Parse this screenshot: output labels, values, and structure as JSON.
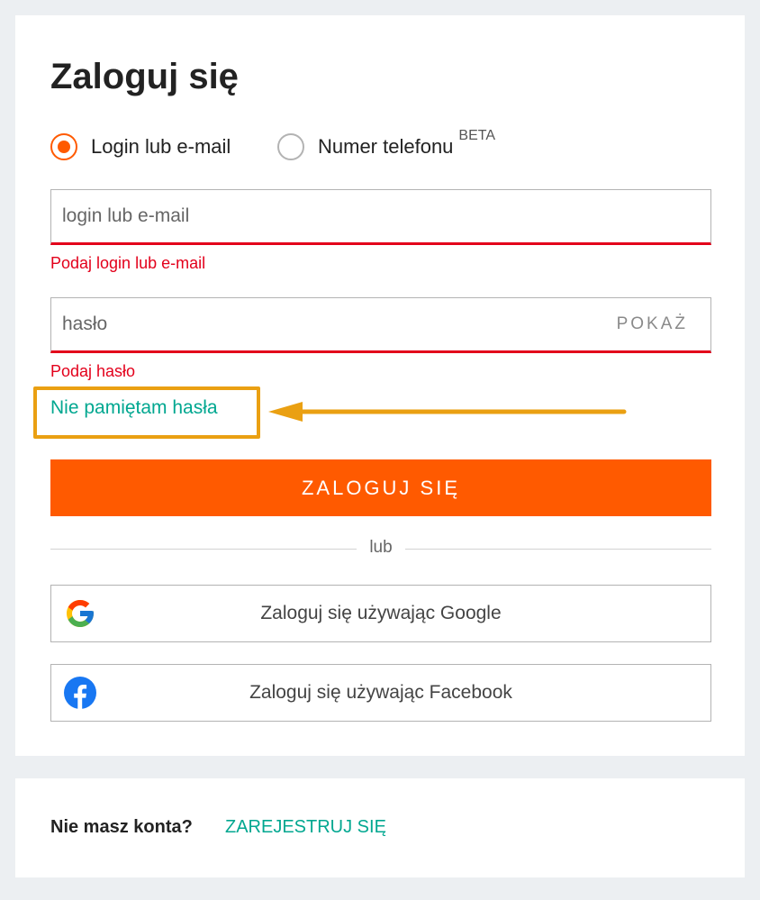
{
  "login": {
    "title": "Zaloguj się",
    "method_options": [
      {
        "label": "Login lub e-mail",
        "selected": true
      },
      {
        "label": "Numer telefonu",
        "badge": "BETA",
        "selected": false
      }
    ],
    "login_field": {
      "placeholder": "login lub e-mail",
      "value": "",
      "error": "Podaj login lub e-mail"
    },
    "password_field": {
      "placeholder": "hasło",
      "value": "",
      "show_label": "POKAŻ",
      "error": "Podaj hasło"
    },
    "forgot_password_label": "Nie pamiętam hasła",
    "submit_label": "ZALOGUJ SIĘ",
    "divider_text": "lub",
    "social": [
      {
        "label": "Zaloguj się używając Google",
        "icon": "google-icon"
      },
      {
        "label": "Zaloguj się używając Facebook",
        "icon": "facebook-icon"
      }
    ]
  },
  "register": {
    "prompt": "Nie masz konta?",
    "link_label": "ZAREJESTRUJ SIĘ"
  },
  "colors": {
    "accent": "#ff5a00",
    "error": "#e3001b",
    "link": "#00a790",
    "annotation": "#eaa012",
    "background": "#eceff2"
  }
}
